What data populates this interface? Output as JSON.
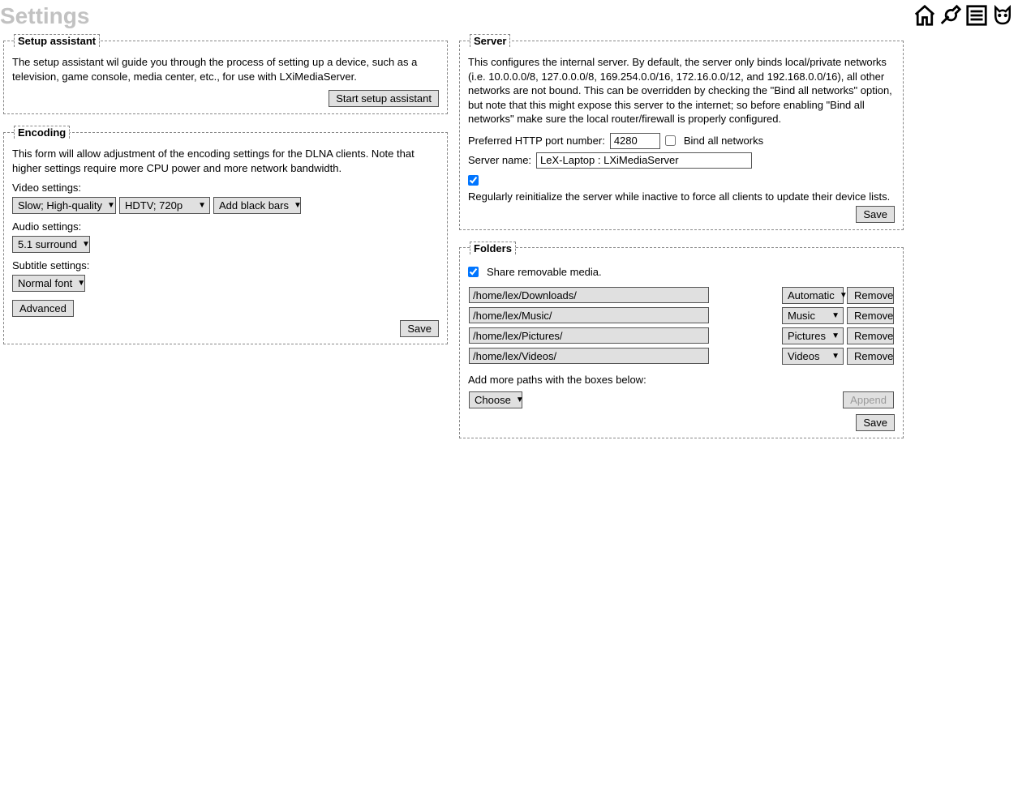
{
  "page_title": "Settings",
  "setup": {
    "legend": "Setup assistant",
    "description": "The setup assistant wil guide you through the process of setting up a device, such as a television, game console, media center, etc., for use with LXiMediaServer.",
    "start_button": "Start setup assistant"
  },
  "server": {
    "legend": "Server",
    "description": "This configures the internal server. By default, the server only binds local/private networks (i.e. 10.0.0.0/8, 127.0.0.0/8, 169.254.0.0/16, 172.16.0.0/12, and 192.168.0.0/16), all other networks are not bound. This can be overridden by checking the \"Bind all networks\" option, but note that this might expose this server to the internet; so before enabling \"Bind all networks\" make sure the local router/firewall is properly configured.",
    "port_label": "Preferred HTTP port number:",
    "port_value": "4280",
    "bind_all_label": "Bind all networks",
    "bind_all_checked": false,
    "server_name_label": "Server name:",
    "server_name_value": "LeX-Laptop : LXiMediaServer",
    "reinit_label": "Regularly reinitialize the server while inactive to force all clients to update their device lists.",
    "reinit_checked": true,
    "save_button": "Save"
  },
  "encoding": {
    "legend": "Encoding",
    "description": "This form will allow adjustment of the encoding settings for the DLNA clients. Note that higher settings require more CPU power and more network bandwidth.",
    "video_label": "Video settings:",
    "video_quality": "Slow; High-quality",
    "video_res": "HDTV; 720p",
    "video_aspect": "Add black bars",
    "audio_label": "Audio settings:",
    "audio_value": "5.1 surround",
    "subtitle_label": "Subtitle settings:",
    "subtitle_value": "Normal font",
    "advanced_button": "Advanced",
    "save_button": "Save"
  },
  "folders": {
    "legend": "Folders",
    "share_removable_label": "Share removable media.",
    "share_removable_checked": true,
    "rows": [
      {
        "path": "/home/lex/Downloads/",
        "type": "Automatic"
      },
      {
        "path": "/home/lex/Music/",
        "type": "Music"
      },
      {
        "path": "/home/lex/Pictures/",
        "type": "Pictures"
      },
      {
        "path": "/home/lex/Videos/",
        "type": "Videos"
      }
    ],
    "remove_button": "Remove",
    "add_more_label": "Add more paths with the boxes below:",
    "choose_button": "Choose",
    "append_button": "Append",
    "save_button": "Save"
  }
}
